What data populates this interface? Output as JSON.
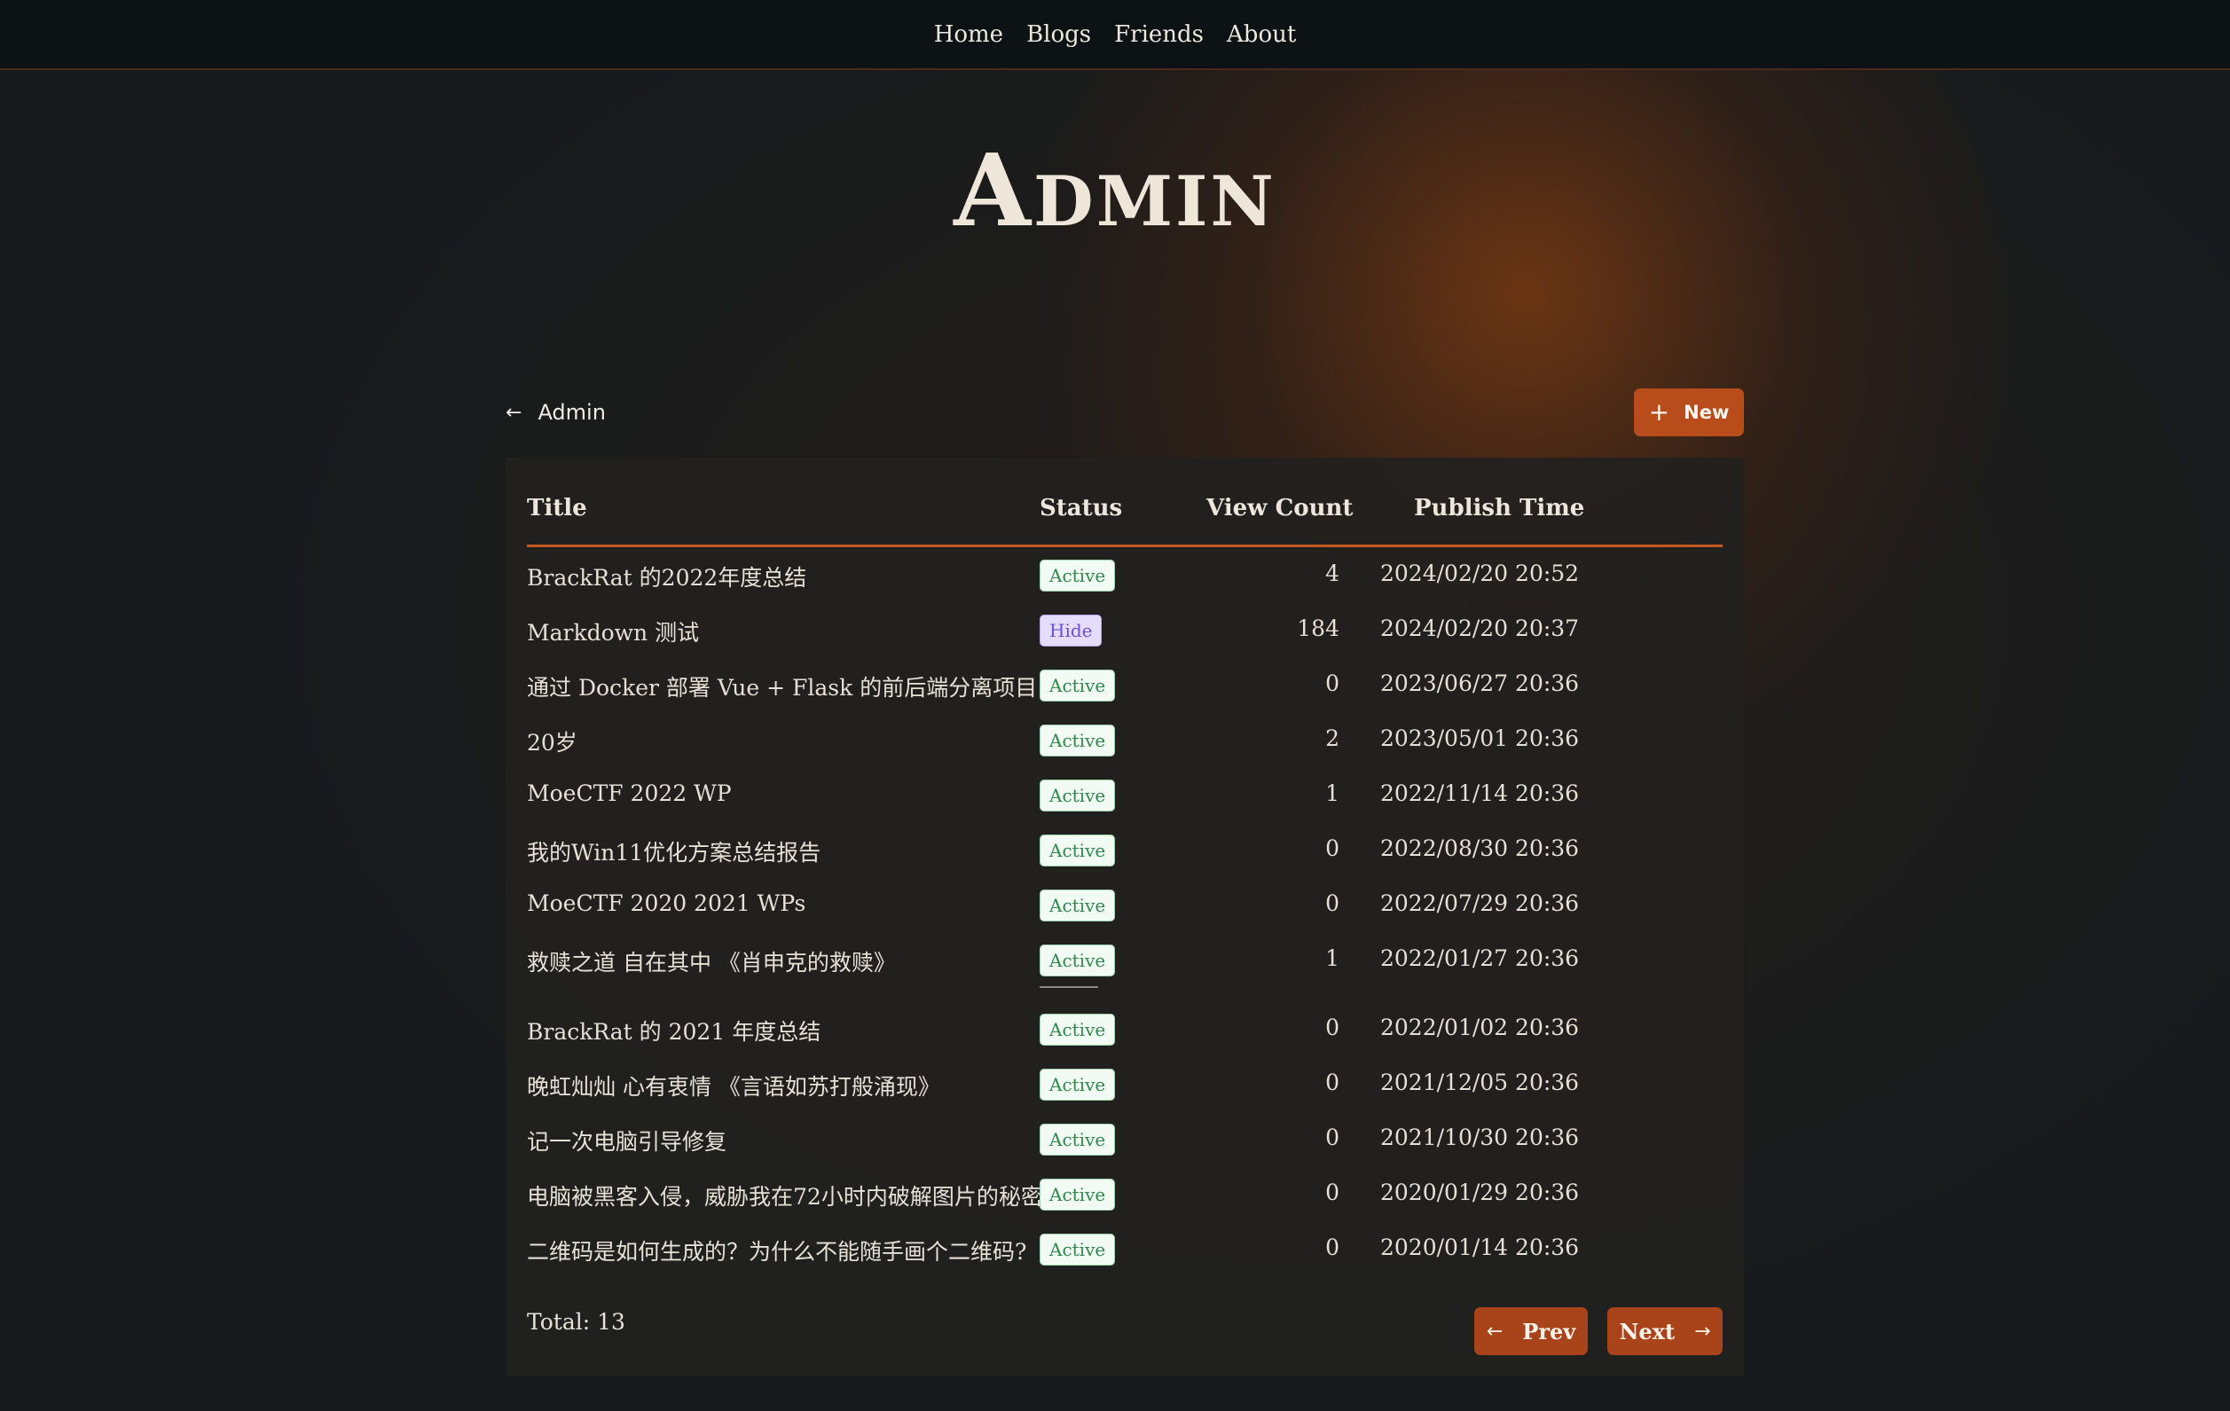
{
  "nav": {
    "items": [
      "Home",
      "Blogs",
      "Friends",
      "About"
    ]
  },
  "page": {
    "title": "Admin"
  },
  "toolbar": {
    "back_label": "Admin",
    "new_label": "New"
  },
  "table": {
    "columns": {
      "title": "Title",
      "status": "Status",
      "views": "View Count",
      "time": "Publish Time"
    },
    "rows": [
      {
        "title": "BrackRat 的2022年度总结",
        "status": "Active",
        "views": "4",
        "time": "2024/02/20 20:52"
      },
      {
        "title": "Markdown 测试",
        "status": "Hide",
        "views": "184",
        "time": "2024/02/20 20:37"
      },
      {
        "title": "通过 Docker 部署 Vue + Flask 的前后端分离项目",
        "status": "Active",
        "views": "0",
        "time": "2023/06/27 20:36"
      },
      {
        "title": "20岁",
        "status": "Active",
        "views": "2",
        "time": "2023/05/01 20:36"
      },
      {
        "title": "MoeCTF 2022 WP",
        "status": "Active",
        "views": "1",
        "time": "2022/11/14 20:36"
      },
      {
        "title": "我的Win11优化方案总结报告",
        "status": "Active",
        "views": "0",
        "time": "2022/08/30 20:36"
      },
      {
        "title": "MoeCTF 2020 2021 WPs",
        "status": "Active",
        "views": "0",
        "time": "2022/07/29 20:36"
      },
      {
        "title": "救赎之道 自在其中 《肖申克的救赎》",
        "status": "Active",
        "views": "1",
        "time": "2022/01/27 20:36"
      },
      {
        "title": "BrackRat 的 2021 年度总结",
        "status": "Active",
        "views": "0",
        "time": "2022/01/02 20:36"
      },
      {
        "title": "晚虹灿灿 心有衷情 《言语如苏打般涌现》",
        "status": "Active",
        "views": "0",
        "time": "2021/12/05 20:36"
      },
      {
        "title": "记一次电脑引导修复",
        "status": "Active",
        "views": "0",
        "time": "2021/10/30 20:36"
      },
      {
        "title": "电脑被黑客入侵，威胁我在72小时内破解图片的秘密?",
        "status": "Active",
        "views": "0",
        "time": "2020/01/29 20:36"
      },
      {
        "title": "二维码是如何生成的？为什么不能随手画个二维码?",
        "status": "Active",
        "views": "0",
        "time": "2020/01/14 20:36"
      }
    ]
  },
  "footer": {
    "total_label": "Total: 13",
    "prev_label": "Prev",
    "next_label": "Next"
  },
  "colors": {
    "accent": "#b84c1a",
    "active_badge": "#2f8a4c",
    "hide_badge": "#6a4fd0"
  },
  "icons": {
    "back": "arrow-left-icon",
    "new": "plus-icon",
    "prev": "arrow-left-icon",
    "next": "arrow-right-icon"
  }
}
